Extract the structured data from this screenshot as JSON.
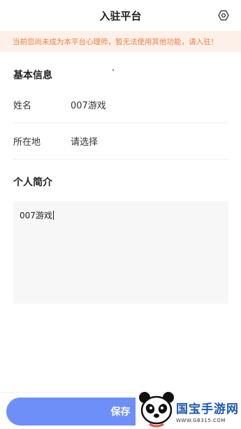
{
  "header": {
    "title": "入驻平台",
    "settings_icon": "settings-hex-icon"
  },
  "notice": {
    "text": "当前您尚未成为本平台心理师，暂无法使用其他功能，请入驻！",
    "color": "#f0804a",
    "background": "#fdf0e8"
  },
  "basic_info": {
    "title": "基本信息",
    "name_label": "姓名",
    "name_value": "007游戏",
    "location_label": "所在地",
    "location_value": "请选择"
  },
  "intro": {
    "title": "个人简介",
    "value": "007游戏"
  },
  "footer": {
    "save_label": "保存",
    "accent": "#6e8ff7"
  },
  "watermark": {
    "title": "国宝手游网",
    "url": "WWW.GB315.COM"
  }
}
